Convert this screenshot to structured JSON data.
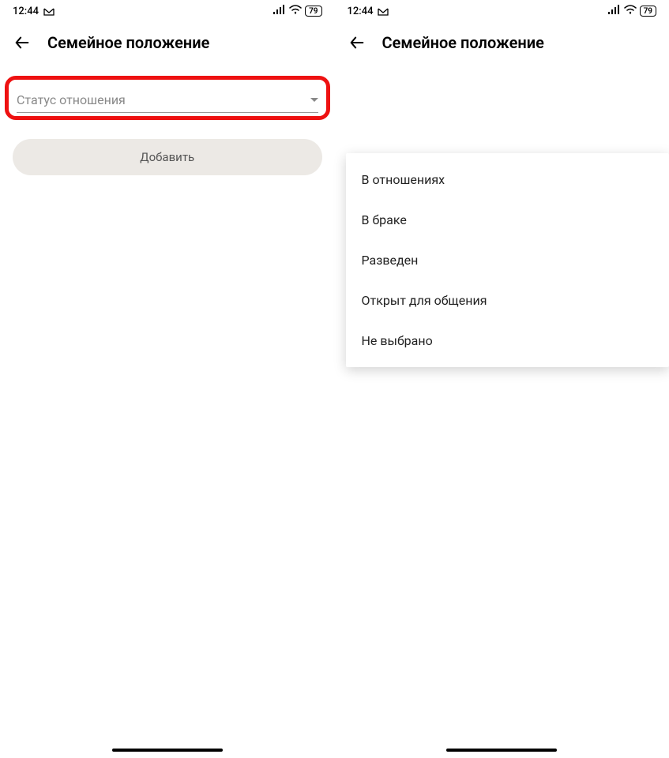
{
  "status": {
    "time": "12:44",
    "battery": "79"
  },
  "header": {
    "title": "Семейное положение"
  },
  "dropdown": {
    "placeholder": "Статус отношения",
    "options": [
      "В отношениях",
      "В браке",
      "Разведен",
      "Открыт для общения",
      "Не выбрано"
    ]
  },
  "buttons": {
    "add": "Добавить"
  }
}
